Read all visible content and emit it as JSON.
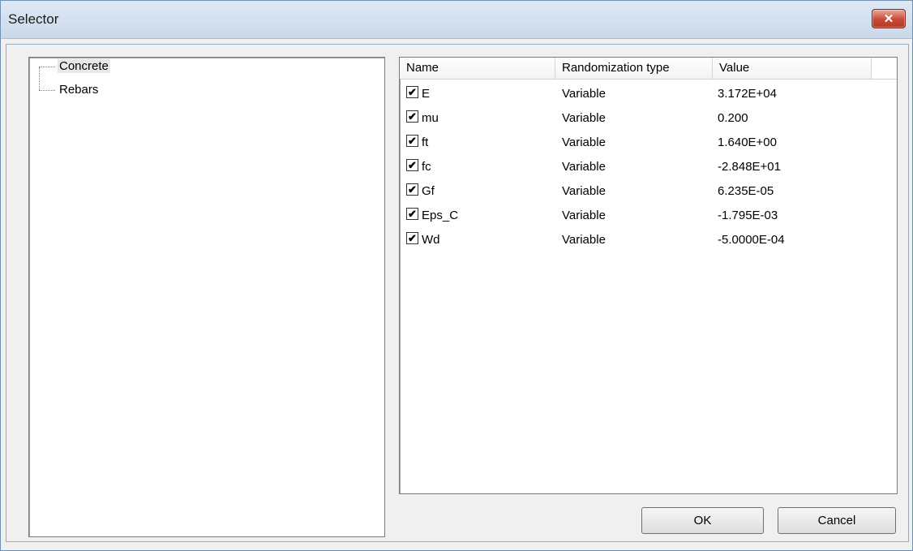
{
  "window": {
    "title": "Selector",
    "close_glyph": "✕"
  },
  "tree": {
    "items": [
      {
        "label": "Concrete",
        "selected": true
      },
      {
        "label": "Rebars",
        "selected": false
      }
    ]
  },
  "list": {
    "columns": [
      "Name",
      "Randomization type",
      "Value"
    ],
    "rows": [
      {
        "checked": true,
        "name": "E",
        "type": "Variable",
        "value": "3.172E+04"
      },
      {
        "checked": true,
        "name": "mu",
        "type": "Variable",
        "value": "0.200"
      },
      {
        "checked": true,
        "name": "ft",
        "type": "Variable",
        "value": "1.640E+00"
      },
      {
        "checked": true,
        "name": "fc",
        "type": "Variable",
        "value": "-2.848E+01"
      },
      {
        "checked": true,
        "name": "Gf",
        "type": "Variable",
        "value": "6.235E-05"
      },
      {
        "checked": true,
        "name": "Eps_C",
        "type": "Variable",
        "value": "-1.795E-03"
      },
      {
        "checked": true,
        "name": "Wd",
        "type": "Variable",
        "value": "-5.0000E-04"
      }
    ]
  },
  "buttons": {
    "ok": "OK",
    "cancel": "Cancel"
  },
  "icons": {
    "checkmark": "check-icon",
    "close": "close-icon"
  }
}
